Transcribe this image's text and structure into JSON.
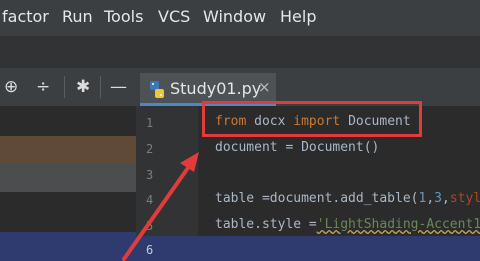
{
  "menu": {
    "refactor": "factor",
    "run": "Run",
    "tools": "Tools",
    "vcs": "VCS",
    "window": "Window",
    "help": "Help"
  },
  "toolbar": {
    "icons": [
      "crosshair-icon",
      "collapse-icon",
      "gear-icon",
      "minimize-icon"
    ]
  },
  "tab": {
    "label": "Study01.py",
    "close": "×"
  },
  "editor": {
    "line_numbers": [
      "1",
      "2",
      "3",
      "4",
      "5",
      "6"
    ],
    "lines": {
      "l1": {
        "kw1": "from",
        "mod": " docx ",
        "kw2": "import",
        "name": " Document"
      },
      "l2": "document = Document()",
      "l4": {
        "pre": "table =document.add_table(",
        "n1": "1",
        "c1": ",",
        "n2": "3",
        "c2": ",",
        "param": "styl"
      },
      "l5": {
        "pre": "table.style =",
        "str": "'LightShading-Accent1"
      }
    }
  },
  "colors": {
    "highlight_box": "#e23b3b",
    "arrow": "#e23b3b",
    "current_line": "#2f3a6e"
  }
}
